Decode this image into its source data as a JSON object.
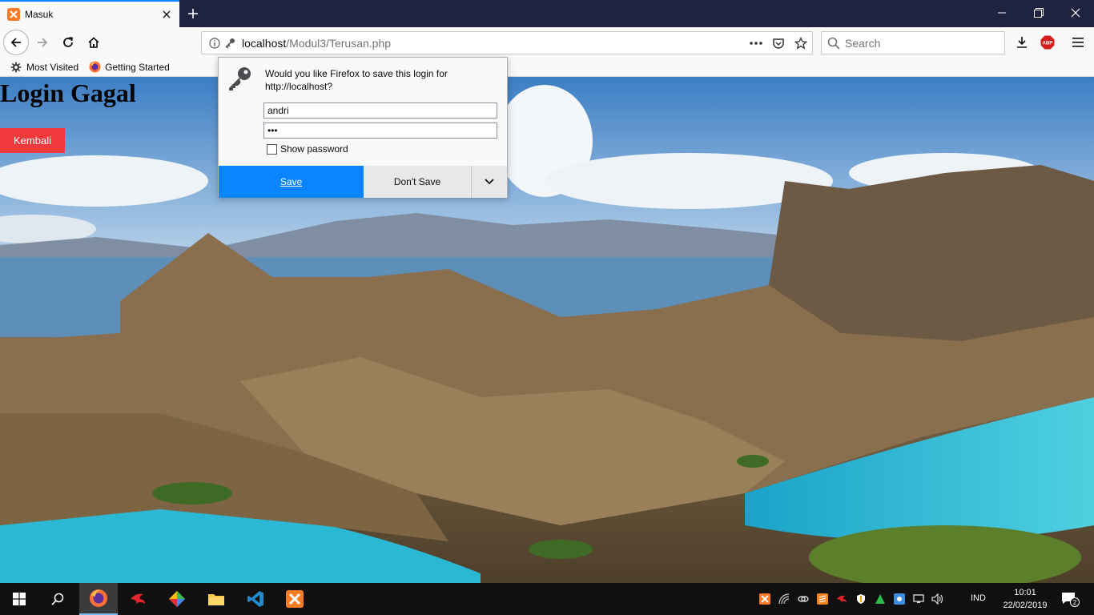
{
  "browser": {
    "tab": {
      "title": "Masuk"
    },
    "url": {
      "host": "localhost",
      "path": "/Modul3/Terusan.php"
    },
    "search": {
      "placeholder": "Search"
    },
    "bookmarks": [
      {
        "label": "Most Visited",
        "icon": "gear-icon"
      },
      {
        "label": "Getting Started",
        "icon": "firefox-icon"
      }
    ]
  },
  "page": {
    "title": "Login Gagal",
    "back_button": "Kembali",
    "accent": "#f0393b"
  },
  "doorhanger": {
    "message": "Would you like Firefox to save this login for http://localhost?",
    "username": "andri",
    "password": "•••",
    "show_password_label": "Show password",
    "save_label": "Save",
    "dont_save_label": "Don't Save",
    "accent": "#0a84ff"
  },
  "taskbar": {
    "language": "IND",
    "time": "10:01",
    "date": "22/02/2019",
    "notification_count": "2"
  }
}
